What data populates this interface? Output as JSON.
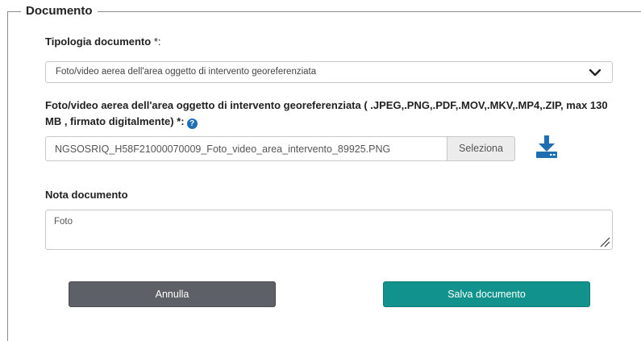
{
  "section": {
    "legend": "Documento"
  },
  "tipologia": {
    "label": "Tipologia documento",
    "required_mark": " *:",
    "selected": "Foto/video aerea dell'area oggetto di intervento georeferenziata"
  },
  "file_field": {
    "label": "Foto/video aerea dell'area oggetto di intervento georeferenziata ( .JPEG,.PNG,.PDF,.MOV,.MKV,.MP4,.ZIP, max 130 MB , firmato digitalmente) *:",
    "help_icon": "?",
    "value": "NGSOSRIQ_H58F21000070009_Foto_video_area_intervento_89925.PNG",
    "select_label": "Seleziona"
  },
  "nota": {
    "label": "Nota documento",
    "value": "Foto"
  },
  "actions": {
    "cancel_label": "Annulla",
    "save_label": "Salva documento"
  },
  "colors": {
    "accent_save": "#12928c",
    "cancel": "#5d6066",
    "download_icon": "#1f6fb2",
    "help_icon": "#1f6fb2"
  },
  "icons": {
    "select_arrow": "chevron-down-icon",
    "download": "download-icon",
    "help": "question-circle-icon",
    "resize": "resize-grip-icon"
  }
}
